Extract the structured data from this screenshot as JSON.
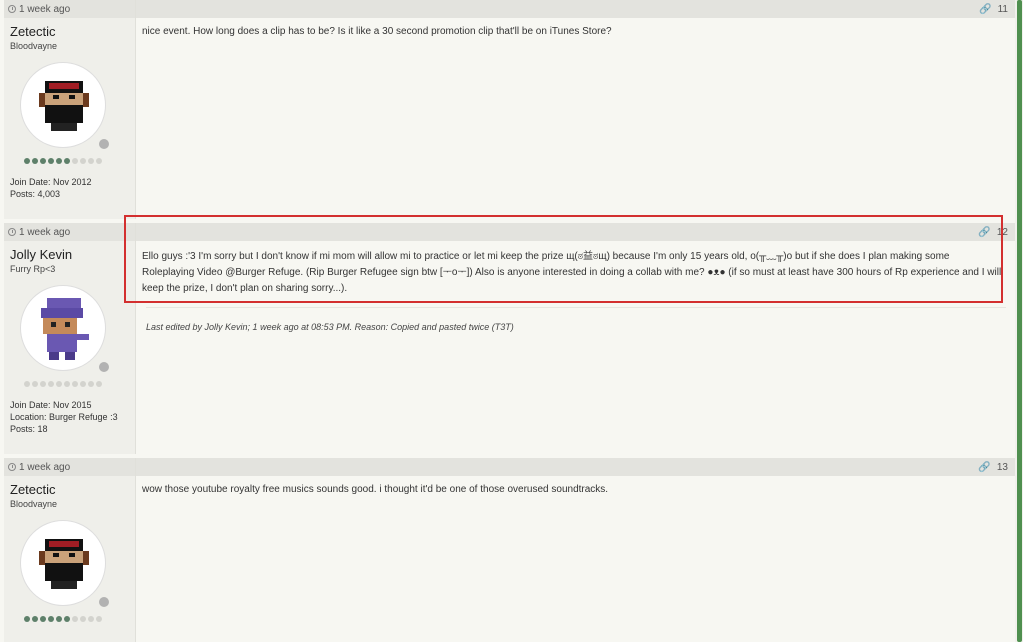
{
  "posts": [
    {
      "time": "1 week ago",
      "number": "11",
      "username": "Zetectic",
      "user_title": "Bloodvayne",
      "rank_filled": 6,
      "rank_total": 10,
      "join_date": "Join Date: Nov 2012",
      "posts": "Posts: 4,003",
      "message": "nice event. How long does a clip has to be? Is it like a 30 second promotion clip that'll be on iTunes Store?"
    },
    {
      "time": "1 week ago",
      "number": "12",
      "username": "Jolly Kevin",
      "user_title": "Furry Rp<3",
      "rank_filled": 0,
      "rank_total": 10,
      "join_date": "Join Date: Nov 2015",
      "location": "Location: Burger Refuge :3",
      "posts": "Posts: 18",
      "message": "Ello guys :'3 I'm sorry but I don't know if mi mom will allow mi to practice or let mi keep the prize щ(ಠ益ಠщ) because I'm only 15 years old, o(╥﹏╥)o but if she does I plan making some Roleplaying Video @Burger Refuge. (Rip Burger Refugee sign btw [ᅮoᅮ]) Also is anyone interested in doing a collab with me? ●ᴥ● (if so must at least have 300 hours of Rp experience and I will keep the prize, I don't plan on sharing sorry...).",
      "edited": "Last edited by Jolly Kevin; 1 week ago at 08:53 PM. Reason: Copied and pasted twice (T3T)"
    },
    {
      "time": "1 week ago",
      "number": "13",
      "username": "Zetectic",
      "user_title": "Bloodvayne",
      "rank_filled": 6,
      "rank_total": 10,
      "message": "wow those youtube royalty free musics sounds good. i thought it'd be one of those overused soundtracks."
    }
  ],
  "colors": {
    "highlight": "#d32f2f",
    "scrollbar": "#4f8f4f",
    "rank_on": "#5e806a",
    "rank_off": "#d3d3ce"
  },
  "icons": {
    "time": "clock-icon",
    "permalink": "link-icon",
    "status": "offline-status-icon"
  }
}
